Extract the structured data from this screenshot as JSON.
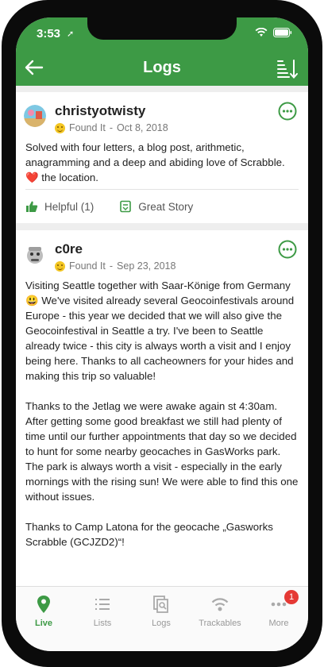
{
  "status_bar": {
    "time": "3:53"
  },
  "nav": {
    "title": "Logs"
  },
  "logs": [
    {
      "username": "christyotwisty",
      "log_type": "Found It",
      "date": "Oct 8, 2018",
      "text_before_heart": "Solved with four letters, a blog post, arithmetic, anagramming and a deep and abiding love of Scrabble.",
      "heart": "❤️",
      "text_after_heart": "the location.",
      "actions": [
        {
          "label": "Helpful (1)",
          "icon": "thumbs-up-icon"
        },
        {
          "label": "Great Story",
          "icon": "story-icon"
        }
      ]
    },
    {
      "username": "c0re",
      "log_type": "Found It",
      "date": "Sep 23, 2018",
      "paragraphs": [
        "Visiting Seattle together with Saar-Könige from Germany 😃 We've visited already several Geocoinfestivals around Europe - this year we decided that we will also give the Geocoinfestival in Seattle a try. I've been to Seattle already twice - this city is always worth a visit and I enjoy being here. Thanks to all cacheowners for your hides and making this trip so valuable!",
        "Thanks to the Jetlag we were awake again st 4:30am. After getting some good breakfast we still had plenty of time until our further appointments that day so we decided to hunt for some nearby geocaches in GasWorks park. The park is always worth a visit - especially in the early mornings with the rising sun! We were able to find this one without issues.",
        "Thanks to Camp Latona for the geocache „Gasworks Scrabble (GCJZD2)“!"
      ]
    }
  ],
  "tabs": [
    {
      "label": "Live",
      "active": true
    },
    {
      "label": "Lists",
      "active": false
    },
    {
      "label": "Logs",
      "active": false
    },
    {
      "label": "Trackables",
      "active": false
    },
    {
      "label": "More",
      "active": false,
      "badge": "1"
    }
  ],
  "colors": {
    "brand_green": "#3d9a45",
    "badge_red": "#e53935"
  }
}
